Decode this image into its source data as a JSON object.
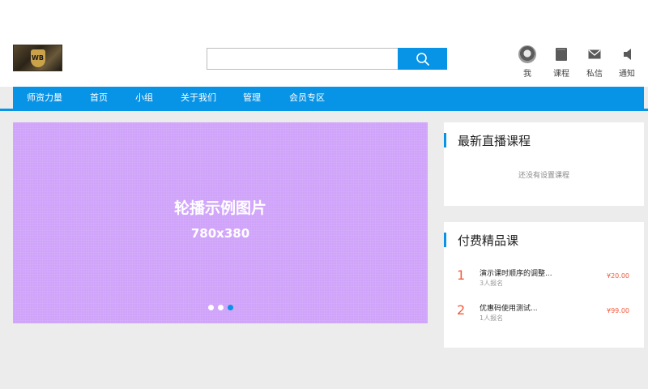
{
  "header": {
    "search": {
      "value": "",
      "placeholder": ""
    },
    "user_menu": [
      {
        "label": "我",
        "icon": "avatar"
      },
      {
        "label": "课程",
        "icon": "book-icon"
      },
      {
        "label": "私信",
        "icon": "mail-icon"
      },
      {
        "label": "通知",
        "icon": "megaphone-icon"
      }
    ]
  },
  "nav": {
    "items": [
      "师资力量",
      "首页",
      "小组",
      "关于我们",
      "管理",
      "会员专区"
    ]
  },
  "banner": {
    "title": "轮播示例图片",
    "size_text": "780x380",
    "slide_count": 3,
    "active_slide": 3
  },
  "live_panel": {
    "title": "最新直播课程",
    "empty_text": "还没有设置课程"
  },
  "paid_panel": {
    "title": "付费精品课",
    "courses": [
      {
        "rank": "1",
        "name": "演示课时顺序的调整...",
        "count": "3人报名",
        "price": "¥20.00"
      },
      {
        "rank": "2",
        "name": "优惠码使用测试...",
        "count": "1人报名",
        "price": "¥99.00"
      }
    ]
  },
  "colors": {
    "primary": "#0793e6",
    "banner": "#cfa3fa",
    "price": "#f25a3c",
    "page_bg": "#ececec"
  }
}
